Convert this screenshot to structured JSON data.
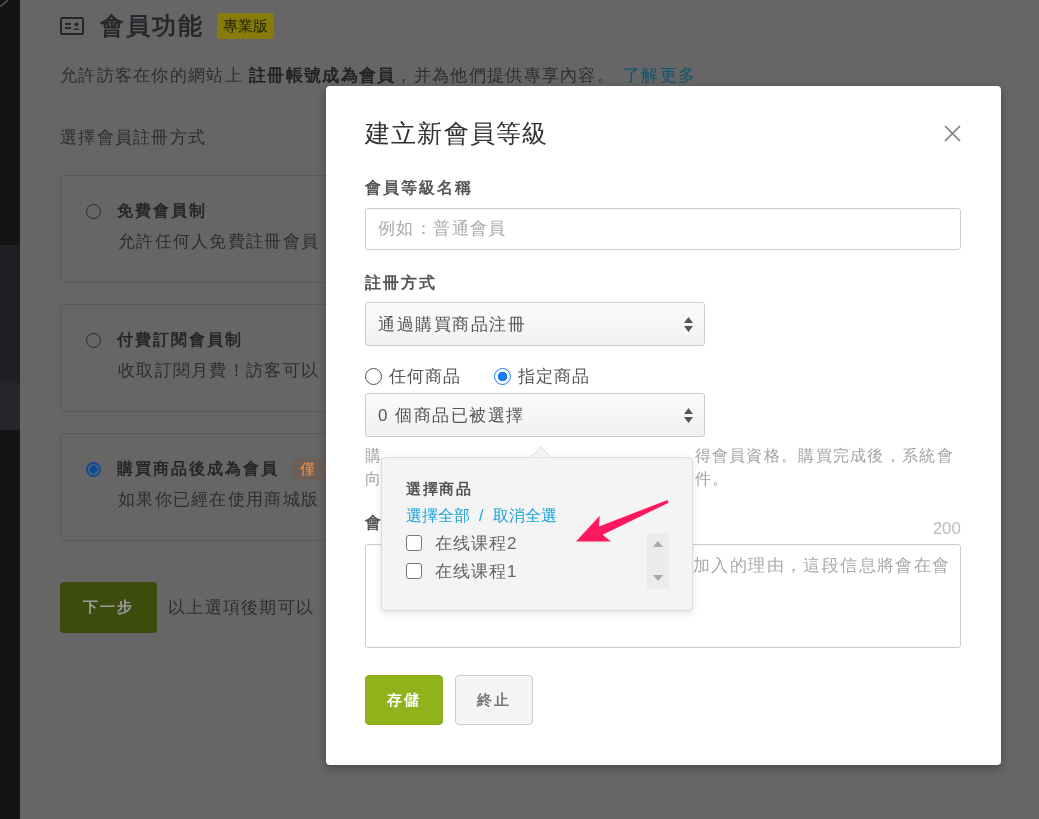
{
  "page": {
    "title": "會員功能",
    "badge": "專業版",
    "description": "允許訪客在你的網站上 **註冊帳號成為會員**，并為他們提供專享內容。",
    "link": "了解更多",
    "section_label": "選擇會員註冊方式",
    "options": [
      {
        "title": "免費會員制",
        "description": "允許任何人免費註冊會員",
        "selected": false
      },
      {
        "title": "付費訂閱會員制",
        "description": "收取訂閱月費！訪客可以",
        "selected": false
      },
      {
        "title": "購買商品後成為會員",
        "badge": "僅",
        "description": "如果你已經在使用商城版",
        "selected": true
      }
    ],
    "next_button": "下一步",
    "hint": "以上選項後期可以"
  },
  "modal": {
    "title": "建立新會員等級",
    "name_field": {
      "label": "會員等級名稱",
      "placeholder": "例如：普通會員"
    },
    "method_field": {
      "label": "註冊方式",
      "value": "通過購買商品注冊"
    },
    "product_scope": [
      {
        "label": "任何商品",
        "selected": false
      },
      {
        "label": "指定商品",
        "selected": true
      }
    ],
    "product_select": {
      "value": "0 個商品已被選擇"
    },
    "help_lines": [
      {
        "left": "購",
        "right": "得會員資格。購買完成後，系統會"
      },
      {
        "left": "向",
        "right": "件。"
      }
    ],
    "note_field": {
      "label": "會",
      "counter": "200",
      "placeholder": "加入的理由，這段信息將會在會"
    },
    "buttons": [
      {
        "label": "存儲",
        "kind": "primary"
      },
      {
        "label": "終止",
        "kind": "secondary"
      }
    ],
    "product_popover": {
      "title": "選擇商品",
      "select_all": "選擇全部",
      "separator": "/",
      "deselect_all": "取消全選",
      "items": [
        {
          "label": "在线课程2",
          "checked": false
        },
        {
          "label": "在线课程1",
          "checked": false
        }
      ]
    }
  }
}
